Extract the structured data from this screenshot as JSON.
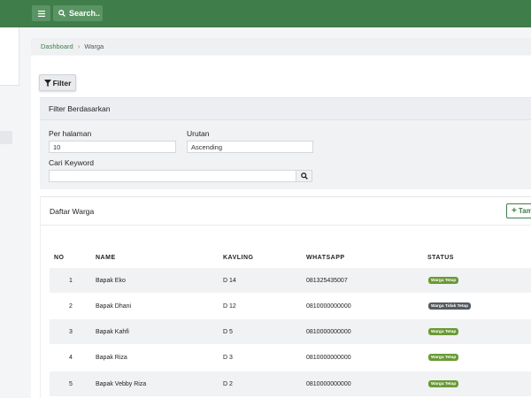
{
  "colors": {
    "brand": "#3f7d4a",
    "badge_tetap": "#6a9a35",
    "badge_tidak_tetap": "#555b61"
  },
  "topbar": {
    "search_label": "Search.."
  },
  "breadcrumb": {
    "home": "Dashboard",
    "current": "Warga"
  },
  "filter_button": {
    "label": "Filter"
  },
  "filter_panel": {
    "title": "Filter Berdasarkan",
    "per_page_label": "Per halaman",
    "per_page_value": "10",
    "sort_label": "Urutan",
    "sort_value": "Ascending",
    "keyword_label": "Cari Keyword",
    "keyword_value": ""
  },
  "list": {
    "title": "Daftar Warga",
    "add_label": "Tam",
    "columns": [
      "NO",
      "NAME",
      "KAVLING",
      "WHATSAPP",
      "STATUS"
    ],
    "rows": [
      {
        "no": "1",
        "name": "Bapak Eko",
        "kavling": "D 14",
        "whatsapp": "081325435007",
        "status": "Warga Tetap",
        "status_color": "#6a9a35"
      },
      {
        "no": "2",
        "name": "Bapak Dhani",
        "kavling": "D 12",
        "whatsapp": "0810000000000",
        "status": "Warga Tidak Tetap",
        "status_color": "#555b61"
      },
      {
        "no": "3",
        "name": "Bapak Kahfi",
        "kavling": "D 5",
        "whatsapp": "0810000000000",
        "status": "Warga Tetap",
        "status_color": "#6a9a35"
      },
      {
        "no": "4",
        "name": "Bapak Riza",
        "kavling": "D 3",
        "whatsapp": "0810000000000",
        "status": "Warga Tetap",
        "status_color": "#6a9a35"
      },
      {
        "no": "5",
        "name": "Bapak Vebby Riza",
        "kavling": "D 2",
        "whatsapp": "0810000000000",
        "status": "Warga Tetap",
        "status_color": "#6a9a35"
      }
    ]
  }
}
